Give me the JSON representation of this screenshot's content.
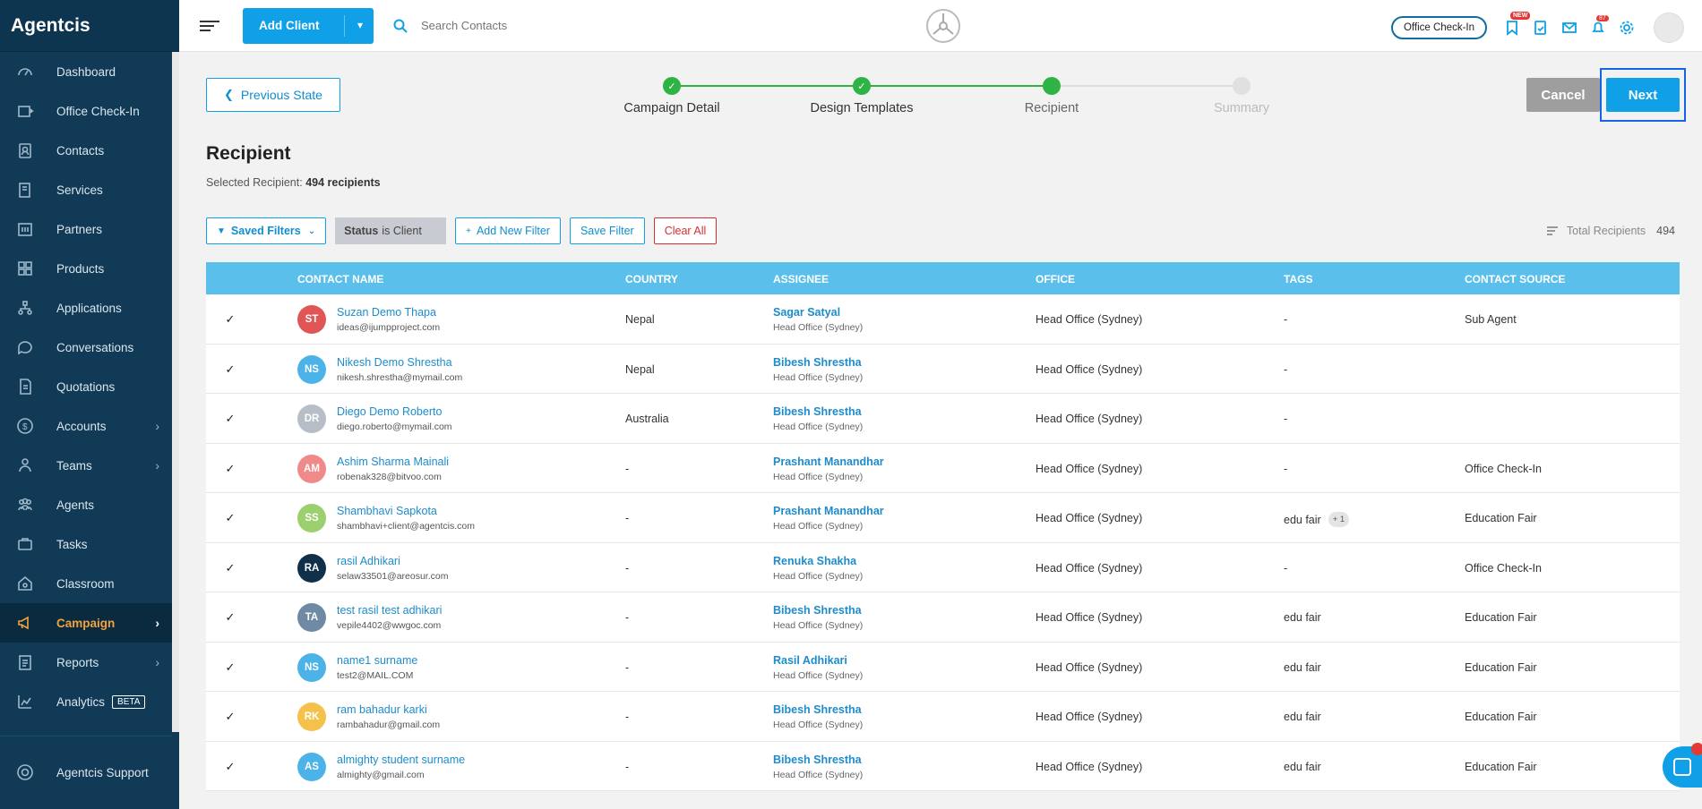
{
  "app": {
    "brand": "Agentcis"
  },
  "sidebar": {
    "items": [
      {
        "label": "Dashboard",
        "icon": "dashboard-icon"
      },
      {
        "label": "Office Check-In",
        "icon": "office-checkin-icon"
      },
      {
        "label": "Contacts",
        "icon": "contacts-icon"
      },
      {
        "label": "Services",
        "icon": "services-icon"
      },
      {
        "label": "Partners",
        "icon": "partners-icon"
      },
      {
        "label": "Products",
        "icon": "products-icon"
      },
      {
        "label": "Applications",
        "icon": "applications-icon"
      },
      {
        "label": "Conversations",
        "icon": "conversations-icon"
      },
      {
        "label": "Quotations",
        "icon": "quotations-icon"
      },
      {
        "label": "Accounts",
        "icon": "accounts-icon",
        "expandable": true
      },
      {
        "label": "Teams",
        "icon": "teams-icon",
        "expandable": true
      },
      {
        "label": "Agents",
        "icon": "agents-icon"
      },
      {
        "label": "Tasks",
        "icon": "tasks-icon"
      },
      {
        "label": "Classroom",
        "icon": "classroom-icon"
      },
      {
        "label": "Campaign",
        "icon": "campaign-icon",
        "expandable": true,
        "active": true
      },
      {
        "label": "Reports",
        "icon": "reports-icon",
        "expandable": true
      },
      {
        "label": "Analytics",
        "icon": "analytics-icon",
        "badge": "BETA"
      }
    ],
    "support": "Agentcis Support"
  },
  "topbar": {
    "add_client": "Add Client",
    "search_placeholder": "Search Contacts",
    "office_checkin": "Office Check-In",
    "new_badge": "NEW",
    "notif_count": "87"
  },
  "wizard": {
    "prev": "Previous State",
    "steps": [
      {
        "label": "Campaign Detail",
        "state": "done"
      },
      {
        "label": "Design Templates",
        "state": "done"
      },
      {
        "label": "Recipient",
        "state": "current"
      },
      {
        "label": "Summary",
        "state": "todo"
      }
    ],
    "cancel": "Cancel",
    "next": "Next"
  },
  "page": {
    "title": "Recipient",
    "selected_label": "Selected Recipient:",
    "selected_value": "494 recipients"
  },
  "filters": {
    "saved": "Saved Filters",
    "chip_key": "Status",
    "chip_rest": "is Client",
    "add": "Add New Filter",
    "save": "Save Filter",
    "clear": "Clear All",
    "total_label": "Total Recipients",
    "total_value": "494"
  },
  "table": {
    "columns": [
      "CONTACT NAME",
      "COUNTRY",
      "ASSIGNEE",
      "OFFICE",
      "TAGS",
      "CONTACT SOURCE"
    ],
    "rows": [
      {
        "initials": "ST",
        "color": "#e05656",
        "name": "Suzan Demo Thapa",
        "email": "ideas@ijumpproject.com",
        "country": "Nepal",
        "assignee": "Sagar Satyal",
        "assignee_office": "Head Office (Sydney)",
        "office": "Head Office (Sydney)",
        "tags": "-",
        "tag_extra": "",
        "source": "Sub Agent"
      },
      {
        "initials": "NS",
        "color": "#4bb3e8",
        "name": "Nikesh Demo Shrestha",
        "email": "nikesh.shrestha@mymail.com",
        "country": "Nepal",
        "assignee": "Bibesh Shrestha",
        "assignee_office": "Head Office (Sydney)",
        "office": "Head Office (Sydney)",
        "tags": "-",
        "tag_extra": "",
        "source": ""
      },
      {
        "initials": "DR",
        "color": "#b7bec7",
        "name": "Diego Demo Roberto",
        "email": "diego.roberto@mymail.com",
        "country": "Australia",
        "assignee": "Bibesh Shrestha",
        "assignee_office": "Head Office (Sydney)",
        "office": "Head Office (Sydney)",
        "tags": "-",
        "tag_extra": "",
        "source": ""
      },
      {
        "initials": "AM",
        "color": "#f08a8a",
        "name": "Ashim Sharma Mainali",
        "email": "robenak328@bitvoo.com",
        "country": "-",
        "assignee": "Prashant Manandhar",
        "assignee_office": "Head Office (Sydney)",
        "office": "Head Office (Sydney)",
        "tags": "-",
        "tag_extra": "",
        "source": "Office Check-In"
      },
      {
        "initials": "SS",
        "color": "#9ccf6e",
        "name": "Shambhavi Sapkota",
        "email": "shambhavi+client@agentcis.com",
        "country": "-",
        "assignee": "Prashant Manandhar",
        "assignee_office": "Head Office (Sydney)",
        "office": "Head Office (Sydney)",
        "tags": "edu fair",
        "tag_extra": "+ 1",
        "source": "Education Fair"
      },
      {
        "initials": "RA",
        "color": "#10304a",
        "name": "rasil Adhikari",
        "email": "selaw33501@areosur.com",
        "country": "-",
        "assignee": "Renuka Shakha",
        "assignee_office": "Head Office (Sydney)",
        "office": "Head Office (Sydney)",
        "tags": "-",
        "tag_extra": "",
        "source": "Office Check-In"
      },
      {
        "initials": "TA",
        "color": "#6e8aa4",
        "name": "test rasil test adhikari",
        "email": "vepile4402@wwgoc.com",
        "country": "-",
        "assignee": "Bibesh Shrestha",
        "assignee_office": "Head Office (Sydney)",
        "office": "Head Office (Sydney)",
        "tags": "edu fair",
        "tag_extra": "",
        "source": "Education Fair"
      },
      {
        "initials": "NS",
        "color": "#4bb3e8",
        "name": "name1 surname",
        "email": "test2@MAIL.COM",
        "country": "-",
        "assignee": "Rasil Adhikari",
        "assignee_office": "Head Office (Sydney)",
        "office": "Head Office (Sydney)",
        "tags": "edu fair",
        "tag_extra": "",
        "source": "Education Fair"
      },
      {
        "initials": "RK",
        "color": "#f4c24a",
        "name": "ram bahadur karki",
        "email": "rambahadur@gmail.com",
        "country": "-",
        "assignee": "Bibesh Shrestha",
        "assignee_office": "Head Office (Sydney)",
        "office": "Head Office (Sydney)",
        "tags": "edu fair",
        "tag_extra": "",
        "source": "Education Fair"
      },
      {
        "initials": "AS",
        "color": "#4bb3e8",
        "name": "almighty student surname",
        "email": "almighty@gmail.com",
        "country": "-",
        "assignee": "Bibesh Shrestha",
        "assignee_office": "Head Office (Sydney)",
        "office": "Head Office (Sydney)",
        "tags": "edu fair",
        "tag_extra": "",
        "source": "Education Fair"
      }
    ]
  },
  "colors": {
    "accent": "#0fa0e8",
    "sidebar": "#103a55",
    "active": "#f0a33d",
    "step_done": "#2fb344",
    "table_header": "#5bbfec"
  }
}
